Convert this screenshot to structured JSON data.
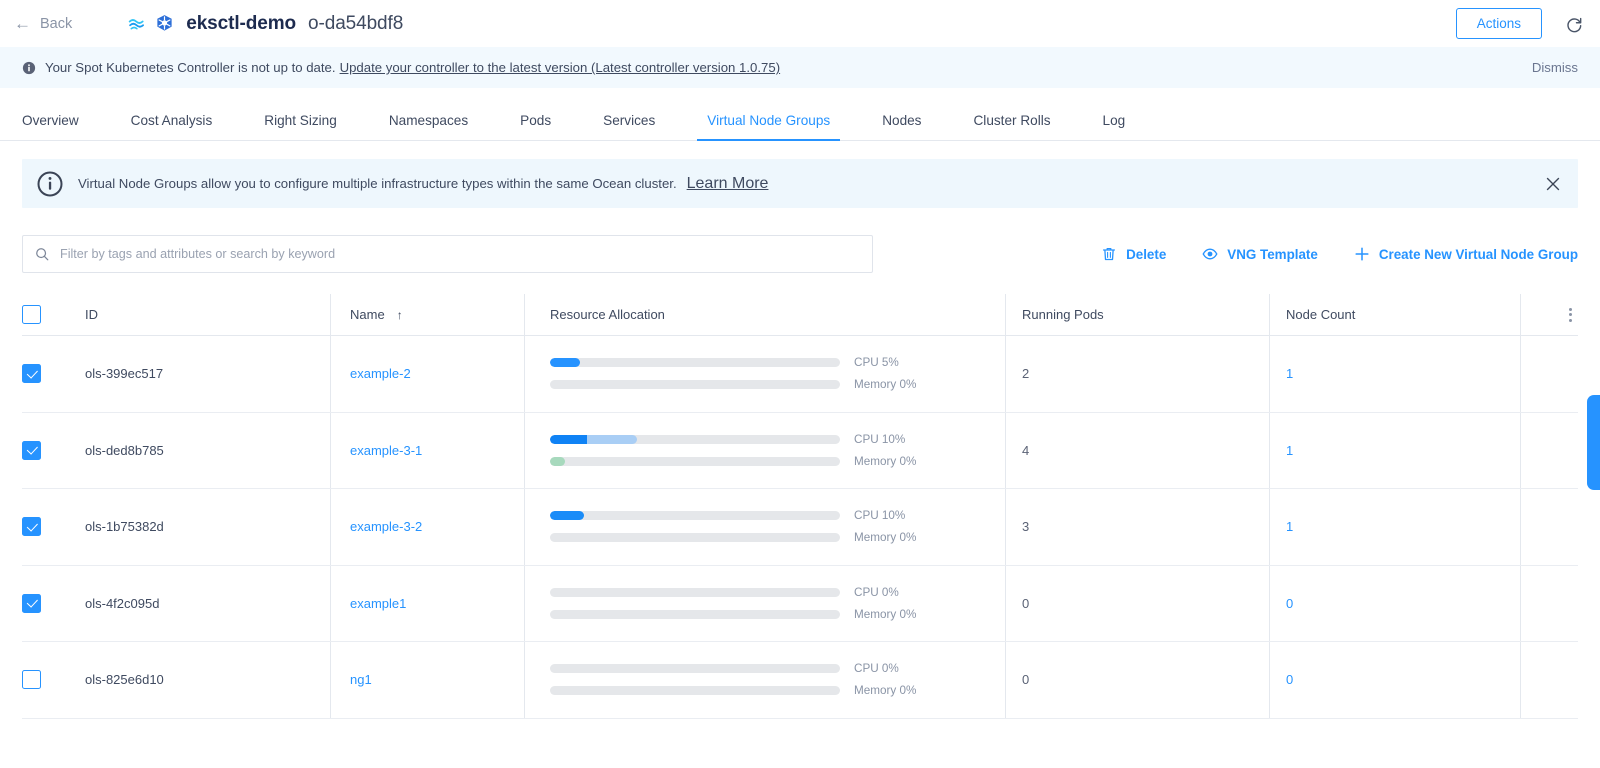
{
  "topbar": {
    "back_label": "Back",
    "cluster_name": "eksctl-demo",
    "cluster_id": "o-da54bdf8",
    "actions_label": "Actions",
    "ocean_icon": "ocean-wave-icon",
    "k8s_icon": "kubernetes-icon",
    "refresh_icon": "refresh-icon"
  },
  "alert": {
    "icon": "info-filled-icon",
    "text": "Your Spot Kubernetes Controller is not up to date.",
    "link": "Update your controller to the latest version (Latest controller version 1.0.75)",
    "dismiss_label": "Dismiss",
    "background": "#f2f9fe"
  },
  "tabs": [
    {
      "label": "Overview",
      "active": false
    },
    {
      "label": "Cost Analysis",
      "active": false
    },
    {
      "label": "Right Sizing",
      "active": false
    },
    {
      "label": "Namespaces",
      "active": false
    },
    {
      "label": "Pods",
      "active": false
    },
    {
      "label": "Services",
      "active": false
    },
    {
      "label": "Virtual Node Groups",
      "active": true
    },
    {
      "label": "Nodes",
      "active": false
    },
    {
      "label": "Cluster Rolls",
      "active": false
    },
    {
      "label": "Log",
      "active": false
    }
  ],
  "banner": {
    "icon": "info-circle-icon",
    "text": "Virtual Node Groups allow you to configure multiple infrastructure types within the same Ocean cluster.",
    "link": "Learn More",
    "close_icon": "close-icon",
    "background": "#eef7fd"
  },
  "toolbar": {
    "search_placeholder": "Filter by tags and attributes or search by keyword",
    "search_value": "",
    "search_icon": "search-icon",
    "delete_label": "Delete",
    "delete_icon": "trash-icon",
    "vng_template_label": "VNG Template",
    "vng_template_icon": "eye-icon",
    "create_label": "Create New Virtual Node Group",
    "create_icon": "plus-icon",
    "accent": "#2693ff"
  },
  "table": {
    "columns": {
      "id": "ID",
      "name": "Name",
      "sort_arrow": "↑",
      "resource_allocation": "Resource Allocation",
      "running_pods": "Running Pods",
      "node_count": "Node Count"
    },
    "header_menu_icon": "kebab-menu-icon",
    "header_checkbox_checked": false,
    "rows": [
      {
        "selected": true,
        "id": "ols-399ec517",
        "name": "example-2",
        "cpu_label": "CPU 5%",
        "cpu_segments": [
          {
            "percent": 10.3,
            "color": "#2693ff"
          }
        ],
        "memory_label": "Memory 0%",
        "memory_segments": [],
        "running_pods": "2",
        "node_count": "1"
      },
      {
        "selected": true,
        "id": "ols-ded8b785",
        "name": "example-3-1",
        "cpu_label": "CPU 10%",
        "cpu_segments": [
          {
            "percent": 14.5,
            "color": "#0f82f5"
          },
          {
            "percent": 17.2,
            "color": "#a9cef5"
          }
        ],
        "memory_label": "Memory 0%",
        "memory_segments": [
          {
            "percent": 5.2,
            "color": "#a7d9bd"
          }
        ],
        "running_pods": "4",
        "node_count": "1"
      },
      {
        "selected": true,
        "id": "ols-1b75382d",
        "name": "example-3-2",
        "cpu_label": "CPU 10%",
        "cpu_segments": [
          {
            "percent": 11.7,
            "color": "#1a8cf8"
          }
        ],
        "memory_label": "Memory 0%",
        "memory_segments": [],
        "running_pods": "3",
        "node_count": "1"
      },
      {
        "selected": true,
        "id": "ols-4f2c095d",
        "name": "example1",
        "cpu_label": "CPU 0%",
        "cpu_segments": [],
        "memory_label": "Memory 0%",
        "memory_segments": [],
        "running_pods": "0",
        "node_count": "0"
      },
      {
        "selected": false,
        "id": "ols-825e6d10",
        "name": "ng1",
        "cpu_label": "CPU 0%",
        "cpu_segments": [],
        "memory_label": "Memory 0%",
        "memory_segments": [],
        "running_pods": "0",
        "node_count": "0"
      }
    ]
  },
  "feedback_tab": {
    "name": "feedback-tab",
    "color": "#2693ff"
  }
}
